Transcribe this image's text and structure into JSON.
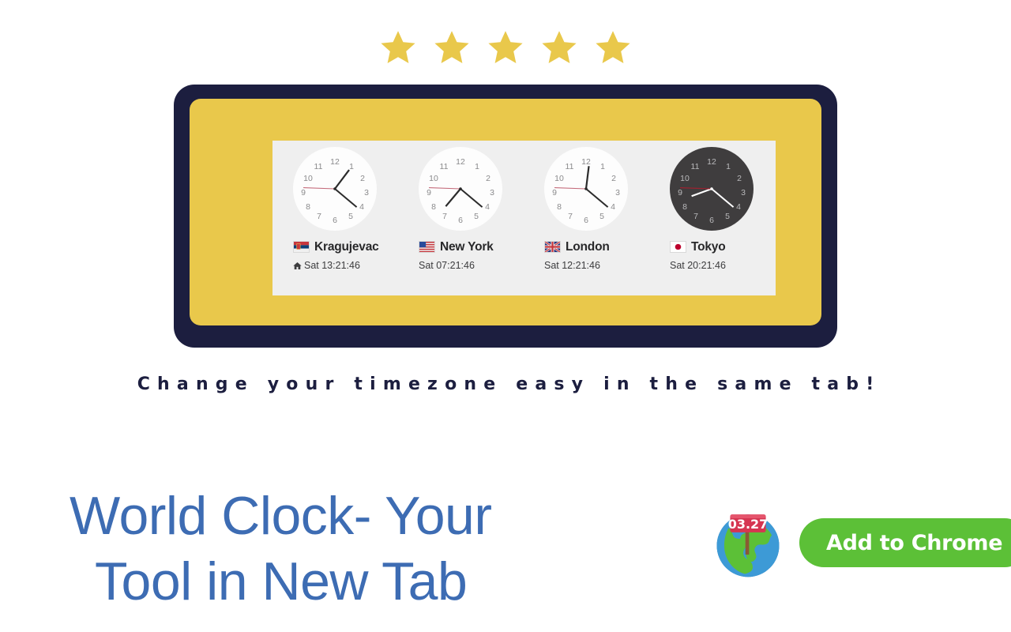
{
  "colors": {
    "star": "#e9c84b",
    "frame": "#1c1e3f",
    "screen": "#e9c84b",
    "panel": "#efefef",
    "headline": "#3d6cb3",
    "cta": "#5cc037",
    "tagline": "#1c1e3f",
    "dark_face": "#3f3d3e",
    "second_hand": "#c46a7a"
  },
  "rating": {
    "stars": 5,
    "star_icon": "star-icon"
  },
  "clocks": [
    {
      "city": "Kragujevac",
      "time": "Sat 13:21:46",
      "flag": "serbia-flag",
      "is_home": true,
      "home_icon": "home-icon",
      "theme": "light",
      "hands": {
        "hour": 37,
        "minute": 130,
        "second": 272
      }
    },
    {
      "city": "New York",
      "time": "Sat 07:21:46",
      "flag": "usa-flag",
      "is_home": false,
      "home_icon": "",
      "theme": "light",
      "hands": {
        "hour": 220,
        "minute": 130,
        "second": 272
      }
    },
    {
      "city": "London",
      "time": "Sat 12:21:46",
      "flag": "uk-flag",
      "is_home": false,
      "home_icon": "",
      "theme": "light",
      "hands": {
        "hour": 7,
        "minute": 130,
        "second": 272
      }
    },
    {
      "city": "Tokyo",
      "time": "Sat 20:21:46",
      "flag": "japan-flag",
      "is_home": false,
      "home_icon": "",
      "theme": "dark",
      "hands": {
        "hour": 250,
        "minute": 130,
        "second": 272
      }
    }
  ],
  "clock_numerals": [
    "12",
    "1",
    "2",
    "3",
    "4",
    "5",
    "6",
    "7",
    "8",
    "9",
    "10",
    "11"
  ],
  "tagline": "Change your timezone easy in the same tab!",
  "headline": {
    "line1": "World Clock- Your",
    "line2": "Tool in New Tab"
  },
  "cta": {
    "button_label": "Add to Chrome",
    "icon": "globe-clock-icon",
    "sign_text": "03.27"
  }
}
